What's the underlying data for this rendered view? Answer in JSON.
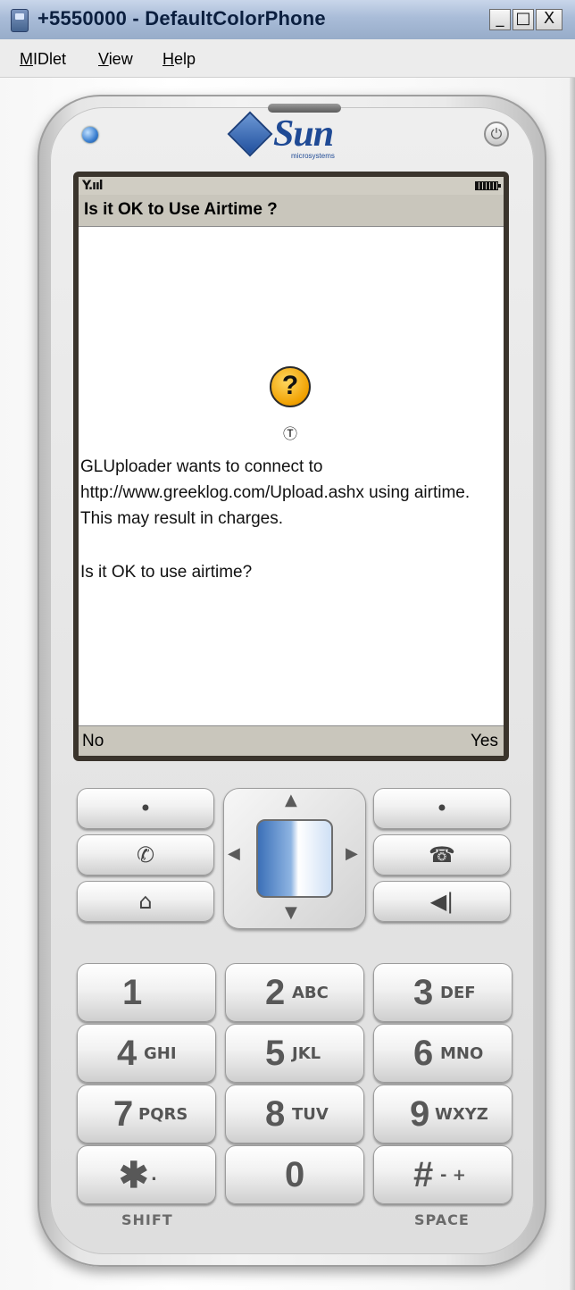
{
  "window": {
    "title": "+5550000 - DefaultColorPhone",
    "controls": {
      "minimize": "_",
      "maximize": "□",
      "close": "X"
    },
    "menu": [
      "MIDlet",
      "View",
      "Help"
    ]
  },
  "phone": {
    "brand": "Sun",
    "brand_sub": "microsystems",
    "power_glyph": "⏻",
    "screen": {
      "signal": "Y.ııl",
      "title": "Is it OK to Use Airtime ?",
      "alert_glyph": "?",
      "trust_glyph": "Ⓣ",
      "message": "GLUploader wants to connect to http://www.greeklog.com/Upload.ashx using airtime. This may result in charges.",
      "question": "Is it OK to use airtime?",
      "softkeys": {
        "left": "No",
        "right": "Yes"
      }
    },
    "softkeys_left": [
      "•",
      "✆",
      "⌂"
    ],
    "softkeys_right": [
      "•",
      "☎",
      "◀|"
    ],
    "dpad_arrows": {
      "up": "▲",
      "down": "▼",
      "left": "◀",
      "right": "▶"
    },
    "keypad": [
      {
        "digit": "1",
        "letters": ""
      },
      {
        "digit": "2",
        "letters": "ABC"
      },
      {
        "digit": "3",
        "letters": "DEF"
      },
      {
        "digit": "4",
        "letters": "GHI"
      },
      {
        "digit": "5",
        "letters": "JKL"
      },
      {
        "digit": "6",
        "letters": "MNO"
      },
      {
        "digit": "7",
        "letters": "PQRS"
      },
      {
        "digit": "8",
        "letters": "TUV"
      },
      {
        "digit": "9",
        "letters": "WXYZ"
      },
      {
        "digit": "✱",
        "letters": "."
      },
      {
        "digit": "0",
        "letters": ""
      },
      {
        "digit": "#",
        "letters": "- +"
      }
    ],
    "labels": {
      "shift": "SHIFT",
      "space": "SPACE"
    }
  }
}
